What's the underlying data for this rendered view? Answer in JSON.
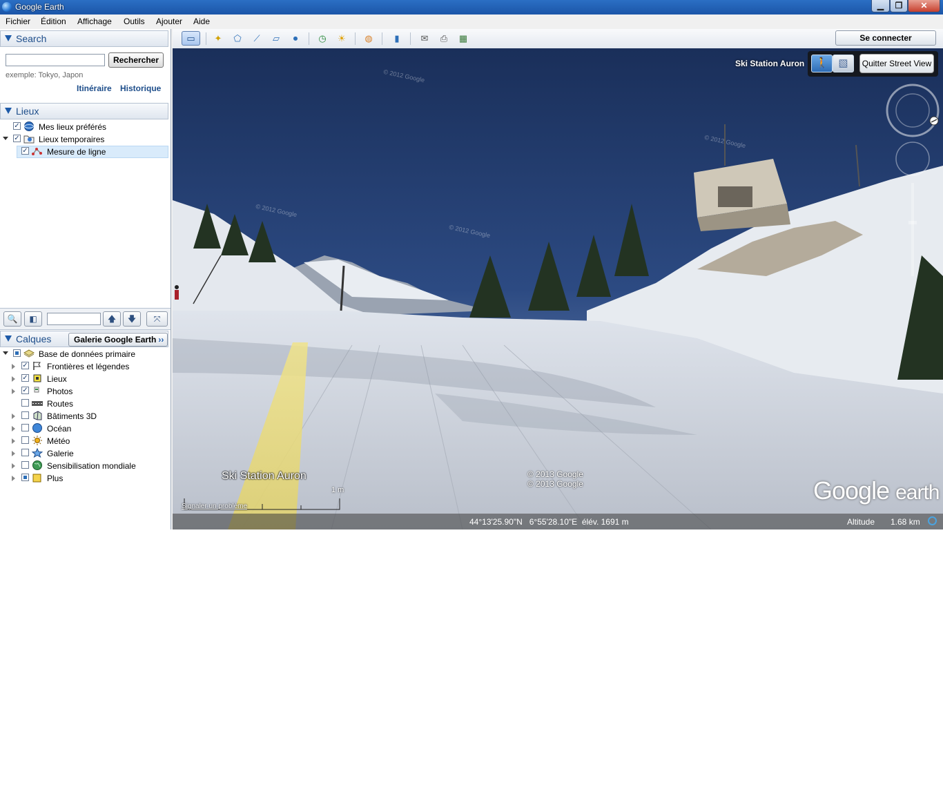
{
  "window": {
    "title": "Google Earth",
    "min_icon": "minimize-icon",
    "max_icon": "maximize-icon",
    "close_icon": "close-icon",
    "min_glyph": "▁",
    "max_glyph": "❐",
    "close_glyph": "✕"
  },
  "menu": [
    "Fichier",
    "Édition",
    "Affichage",
    "Outils",
    "Ajouter",
    "Aide"
  ],
  "search": {
    "header": "Search",
    "input_value": "",
    "button": "Rechercher",
    "example": "exemple: Tokyo, Japon",
    "link_directions": "Itinéraire",
    "link_history": "Historique"
  },
  "places": {
    "header": "Lieux",
    "items": [
      {
        "label": "Mes lieux préférés",
        "checked": true
      },
      {
        "label": "Lieux temporaires",
        "checked": true
      },
      {
        "label": "Mesure de ligne",
        "checked": true
      }
    ]
  },
  "places_toolbar": {
    "search_glyph": "🔍",
    "panel_glyph": "◧",
    "filter_value": "",
    "up_glyph": "🡅",
    "down_glyph": "🡇",
    "tour_glyph": "⤧"
  },
  "layers": {
    "header": "Calques",
    "gallery_button": "Galerie Google Earth",
    "gallery_chevron": "››",
    "items": [
      {
        "label": "Base de données primaire",
        "checked": "partial"
      },
      {
        "label": "Frontières et légendes",
        "checked": true
      },
      {
        "label": "Lieux",
        "checked": true
      },
      {
        "label": "Photos",
        "checked": true
      },
      {
        "label": "Routes",
        "checked": false
      },
      {
        "label": "Bâtiments 3D",
        "checked": false
      },
      {
        "label": "Océan",
        "checked": false
      },
      {
        "label": "Météo",
        "checked": false
      },
      {
        "label": "Galerie",
        "checked": false
      },
      {
        "label": "Sensibilisation mondiale",
        "checked": false
      },
      {
        "label": "Plus",
        "checked": "partial"
      }
    ]
  },
  "toolbar": {
    "signin": "Se connecter",
    "glyphs": {
      "sidebar": "▭",
      "placemark": "✦",
      "polygon": "⬠",
      "path": "⟋",
      "overlay": "▱",
      "tour": "⏺",
      "history": "◷",
      "sun": "☀",
      "planets": "◍",
      "ruler": "▮",
      "email": "✉",
      "print": "⎙",
      "maps": "▦"
    }
  },
  "streetview": {
    "title": "Ski Station Auron",
    "exit_button": "Quitter Street View",
    "person_glyph": "🚶",
    "building_glyph": "▧",
    "watermark": "© 2012 Google",
    "place_label": "Ski Station Auron",
    "scale": "1  m",
    "report": "Signaler un problème",
    "copyright_1": "© 2013 Google",
    "copyright_2": "© 2013 Google",
    "logo_google": "Google",
    "logo_earth": "earth"
  },
  "status": {
    "coords": "44°13'25.90\"N   6°55'28.10\"E  élév. 1691 m",
    "altitude_label": "Altitude",
    "altitude_value": "1.68 km"
  },
  "colors": {
    "title_bar": "#1b55a8",
    "accent": "#1d4d8a",
    "sky": "#26406f",
    "snow": "#e8ebef",
    "path_highlight": "#e6d76a"
  }
}
